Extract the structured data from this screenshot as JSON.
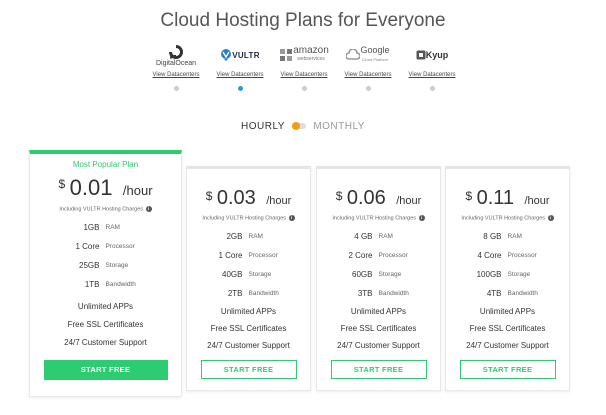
{
  "header": {
    "title": "Cloud Hosting Plans for Everyone"
  },
  "providers": [
    {
      "name": "DigitalOcean",
      "link": "View Datacenters",
      "icon": "digitalocean-logo",
      "active": false
    },
    {
      "name": "VULTR",
      "link": "View Datacenters",
      "icon": "vultr-logo",
      "active": true
    },
    {
      "name": "amazon",
      "sub": "webservices",
      "link": "View Datacenters",
      "icon": "amazon-logo",
      "active": false
    },
    {
      "name": "Google",
      "sub": "Cloud Platform",
      "link": "View Datacenters",
      "icon": "google-logo",
      "active": false
    },
    {
      "name": "Kyup",
      "link": "View Datacenters",
      "icon": "kyup-logo",
      "active": false
    }
  ],
  "billing_toggle": {
    "hourly": "HOURLY",
    "monthly": "MONTHLY",
    "selected": "hourly"
  },
  "plans": [
    {
      "badge": "Most Popular Plan",
      "currency": "$",
      "price": "0.01",
      "period": "/hour",
      "charges": "Including VULTR Hosting Charges",
      "specs": [
        {
          "value": "1GB",
          "unit": "RAM"
        },
        {
          "value": "1 Core",
          "unit": "Processor"
        },
        {
          "value": "25GB",
          "unit": "Storage"
        },
        {
          "value": "1TB",
          "unit": "Bandwidth"
        }
      ],
      "features": [
        "Unlimited APPs",
        "Free SSL Certificates",
        "24/7 Customer Support"
      ],
      "cta": "START FREE"
    },
    {
      "currency": "$",
      "price": "0.03",
      "period": "/hour",
      "charges": "Including VULTR Hosting Charges",
      "specs": [
        {
          "value": "2GB",
          "unit": "RAM"
        },
        {
          "value": "1 Core",
          "unit": "Processor"
        },
        {
          "value": "40GB",
          "unit": "Storage"
        },
        {
          "value": "2TB",
          "unit": "Bandwidth"
        }
      ],
      "features": [
        "Unlimited APPs",
        "Free SSL Certificates",
        "24/7 Customer Support"
      ],
      "cta": "START FREE"
    },
    {
      "currency": "$",
      "price": "0.06",
      "period": "/hour",
      "charges": "Including VULTR Hosting Charges",
      "specs": [
        {
          "value": "4 GB",
          "unit": "RAM"
        },
        {
          "value": "2 Core",
          "unit": "Processor"
        },
        {
          "value": "60GB",
          "unit": "Storage"
        },
        {
          "value": "3TB",
          "unit": "Bandwidth"
        }
      ],
      "features": [
        "Unlimited APPs",
        "Free SSL Certificates",
        "24/7 Customer Support"
      ],
      "cta": "START FREE"
    },
    {
      "currency": "$",
      "price": "0.11",
      "period": "/hour",
      "charges": "Including VULTR Hosting Charges",
      "specs": [
        {
          "value": "8 GB",
          "unit": "RAM"
        },
        {
          "value": "4 Core",
          "unit": "Processor"
        },
        {
          "value": "100GB",
          "unit": "Storage"
        },
        {
          "value": "4TB",
          "unit": "Bandwidth"
        }
      ],
      "features": [
        "Unlimited APPs",
        "Free SSL Certificates",
        "24/7 Customer Support"
      ],
      "cta": "START FREE"
    }
  ],
  "colors": {
    "accent": "#2ecc71",
    "active_dot": "#2a9bd8",
    "toggle_knob": "#f39c12"
  }
}
